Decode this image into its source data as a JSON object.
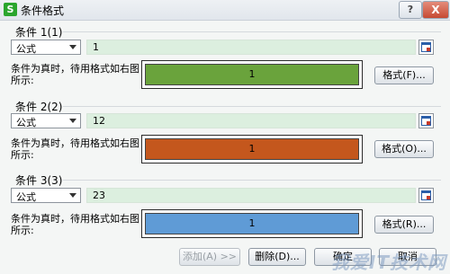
{
  "window": {
    "title": "条件格式",
    "app_icon": "S",
    "help_label": "?",
    "close_label": "X"
  },
  "conditions": [
    {
      "label": "条件 1(1)",
      "operator": "公式",
      "value": "1",
      "description": "条件为真时，待用格式如右图所示:",
      "preview_text": "1",
      "preview_color": "#6aa33c",
      "format_button": "格式(F)..."
    },
    {
      "label": "条件 2(2)",
      "operator": "公式",
      "value": "12",
      "description": "条件为真时，待用格式如右图所示:",
      "preview_text": "1",
      "preview_color": "#c4571d",
      "format_button": "格式(O)..."
    },
    {
      "label": "条件 3(3)",
      "operator": "公式",
      "value": "23",
      "description": "条件为真时，待用格式如右图所示:",
      "preview_text": "1",
      "preview_color": "#5f9bd6",
      "format_button": "格式(R)..."
    }
  ],
  "footer": {
    "add_label": "添加(A) >>",
    "delete_label": "删除(D)...",
    "ok_label": "确定",
    "cancel_label": "取消"
  },
  "watermark": "我爱IT技术网"
}
